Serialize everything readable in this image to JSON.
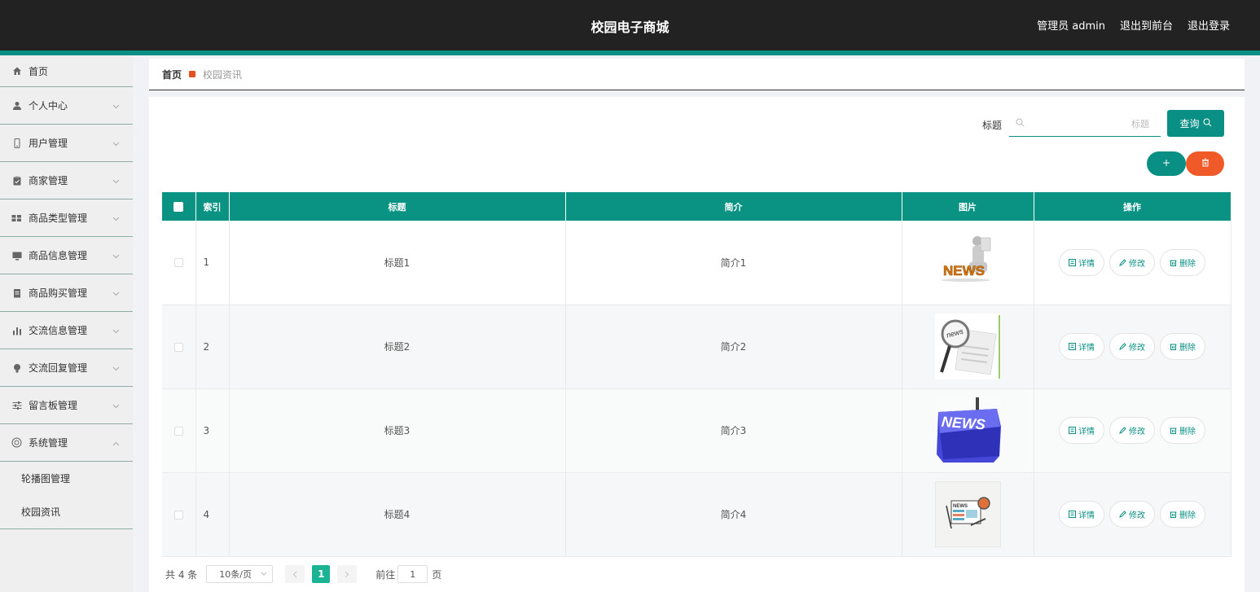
{
  "header": {
    "title": "校园电子商城",
    "admin_label": "管理员 admin",
    "to_front": "退出到前台",
    "logout": "退出登录"
  },
  "sidebar": {
    "items": [
      {
        "label": "首页",
        "icon": "home-icon"
      },
      {
        "label": "个人中心",
        "icon": "user-icon"
      },
      {
        "label": "用户管理",
        "icon": "phone-icon"
      },
      {
        "label": "商家管理",
        "icon": "clipboard-icon"
      },
      {
        "label": "商品类型管理",
        "icon": "grid-icon"
      },
      {
        "label": "商品信息管理",
        "icon": "monitor-icon"
      },
      {
        "label": "商品购买管理",
        "icon": "doc-icon"
      },
      {
        "label": "交流信息管理",
        "icon": "bar-chart-icon"
      },
      {
        "label": "交流回复管理",
        "icon": "bulb-icon"
      },
      {
        "label": "留言板管理",
        "icon": "sliders-icon"
      },
      {
        "label": "系统管理",
        "icon": "settings-icon"
      }
    ],
    "sub_items": [
      "轮播图管理",
      "校园资讯"
    ]
  },
  "breadcrumb": {
    "home": "首页",
    "current": "校园资讯"
  },
  "search": {
    "label": "标题",
    "placeholder": "标题",
    "button": "查询"
  },
  "table": {
    "headers": [
      "索引",
      "标题",
      "简介",
      "图片",
      "操作"
    ],
    "rows": [
      {
        "index": "1",
        "title": "标题1",
        "intro": "简介1"
      },
      {
        "index": "2",
        "title": "标题2",
        "intro": "简介2"
      },
      {
        "index": "3",
        "title": "标题3",
        "intro": "简介3"
      },
      {
        "index": "4",
        "title": "标题4",
        "intro": "简介4"
      }
    ],
    "actions": {
      "detail": "详情",
      "edit": "修改",
      "delete": "删除"
    }
  },
  "pagination": {
    "total": "共 4 条",
    "page_size": "10条/页",
    "current_page": "1",
    "goto_label": "前往",
    "goto_value": "1",
    "page_unit": "页"
  },
  "colors": {
    "primary": "#0a8f84",
    "danger": "#f05a28",
    "header_bg": "#222222"
  }
}
